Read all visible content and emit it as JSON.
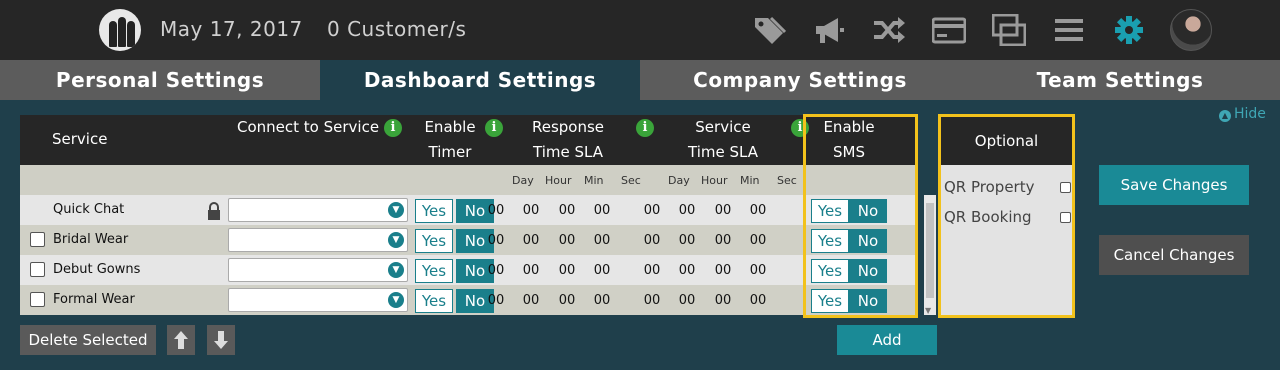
{
  "header": {
    "date": "May 17, 2017",
    "customers": "0 Customer/s",
    "icons": [
      "tag-icon",
      "megaphone-icon",
      "shuffle-icon",
      "credit-card-icon",
      "screens-icon",
      "menu-icon",
      "gear-icon"
    ]
  },
  "tabs": [
    {
      "label": "Personal Settings",
      "active": false
    },
    {
      "label": "Dashboard Settings",
      "active": true
    },
    {
      "label": "Company Settings",
      "active": false
    },
    {
      "label": "Team Settings",
      "active": false
    }
  ],
  "hide_label": "Hide",
  "table": {
    "col_service": "Service",
    "col_connect": "Connect to Service",
    "col_enable_timer": [
      "Enable",
      "Timer"
    ],
    "col_response_sla": [
      "Response",
      "Time SLA"
    ],
    "col_service_sla": [
      "Service",
      "Time SLA"
    ],
    "col_enable_sms": [
      "Enable",
      "SMS"
    ],
    "time_units": [
      "Day",
      "Hour",
      "Min",
      "Sec"
    ],
    "yes_label": "Yes",
    "no_label": "No",
    "zero": "00",
    "rows": [
      {
        "name": "Quick Chat",
        "locked": true
      },
      {
        "name": "Bridal Wear",
        "locked": false
      },
      {
        "name": "Debut Gowns",
        "locked": false
      },
      {
        "name": "Formal Wear",
        "locked": false
      }
    ]
  },
  "optional": {
    "title": "Optional",
    "items": [
      "QR Property",
      "QR Booking"
    ]
  },
  "buttons": {
    "save": "Save Changes",
    "cancel": "Cancel Changes",
    "delete": "Delete Selected",
    "add": "Add"
  },
  "colors": {
    "accent": "#1a8a96",
    "highlight": "#f2c21c",
    "background": "#1f3f4b"
  }
}
